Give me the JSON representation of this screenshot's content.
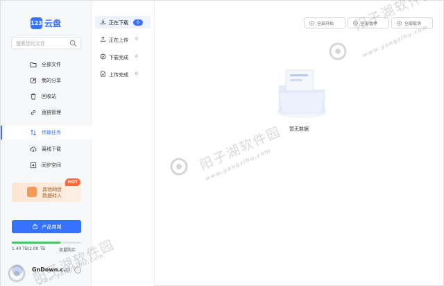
{
  "app": {
    "logo_badge": "123",
    "logo_text": "云盘"
  },
  "search": {
    "placeholder": "搜索您的文件"
  },
  "sidebar": {
    "items": [
      {
        "label": "全部文件",
        "icon": "folder-icon"
      },
      {
        "label": "我的分享",
        "icon": "share-icon"
      },
      {
        "label": "回收站",
        "icon": "trash-icon"
      },
      {
        "label": "直链管理",
        "icon": "link-icon"
      },
      {
        "label": "传输任务",
        "icon": "transfer-icon",
        "active": true
      },
      {
        "label": "离线下载",
        "icon": "cloud-download-icon"
      },
      {
        "label": "同步空间",
        "icon": "sync-icon"
      }
    ]
  },
  "promo": {
    "line1": "其他网盘",
    "line2": "数据转入",
    "hot": "HOT"
  },
  "mall": {
    "label": "产品商城"
  },
  "storage": {
    "text": "1.40 TB/2.00 TB",
    "used_fraction": 0.7,
    "link": "容量购买"
  },
  "user": {
    "name": "GnDown.c..."
  },
  "tasks": [
    {
      "label": "正在下载",
      "count": "0",
      "active": true
    },
    {
      "label": "正在上传",
      "count": "0"
    },
    {
      "label": "下载完成",
      "count": "0"
    },
    {
      "label": "上传完成",
      "count": "0"
    }
  ],
  "toolbar": {
    "start_all": "全部开始",
    "pause_all": "全部暂停",
    "cancel_all": "全部取消"
  },
  "empty": {
    "text": "暂无数据"
  },
  "watermark": {
    "site_name": "阳子湖软件园",
    "site_url": "www.yangzihu.com"
  },
  "colors": {
    "accent": "#3772ff",
    "progress": "#49c75e",
    "hot": "#ff6a3d"
  }
}
